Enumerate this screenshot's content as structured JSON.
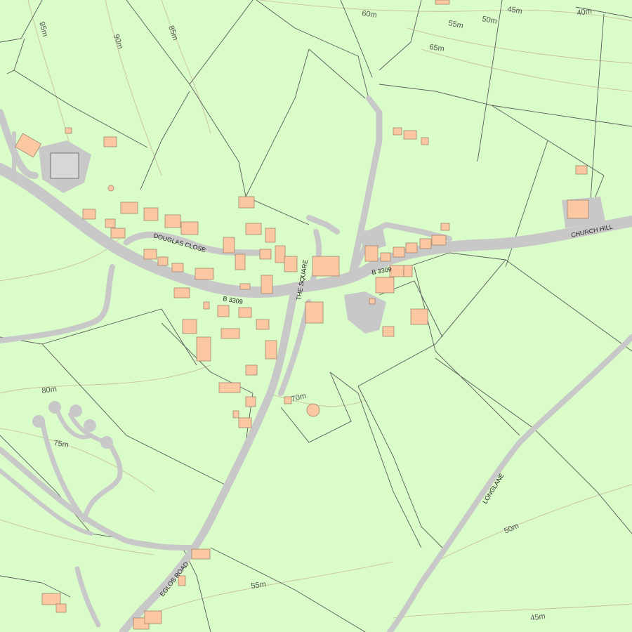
{
  "map": {
    "colors": {
      "land": "#d9fcc8",
      "road": "#c8c8c8",
      "building": "#fbc8a2",
      "building_stroke": "#9a7a66",
      "field_boundary": "#5a5a5a",
      "contour": "#c9b89a"
    },
    "road_labels": {
      "douglas_close": "DOUGLAS CLOSE",
      "b3309_west": "B 3309",
      "b3309_east": "B 3309",
      "the_square": "THE SQUARE",
      "church_hill": "CHURCH HILL",
      "eglos_road": "EGLOS ROAD",
      "longlane": "LONGLANE"
    },
    "contour_labels": {
      "c95": "95m",
      "c90": "90m",
      "c85": "85m",
      "c60": "60m",
      "c55_top": "55m",
      "c50_top": "50m",
      "c45_top": "45m",
      "c40": "40m",
      "c65": "65m",
      "c80": "80m",
      "c75": "75m",
      "c70": "70m",
      "c55_bottom": "55m",
      "c50_bottom": "50m",
      "c45_bottom": "45m"
    }
  }
}
